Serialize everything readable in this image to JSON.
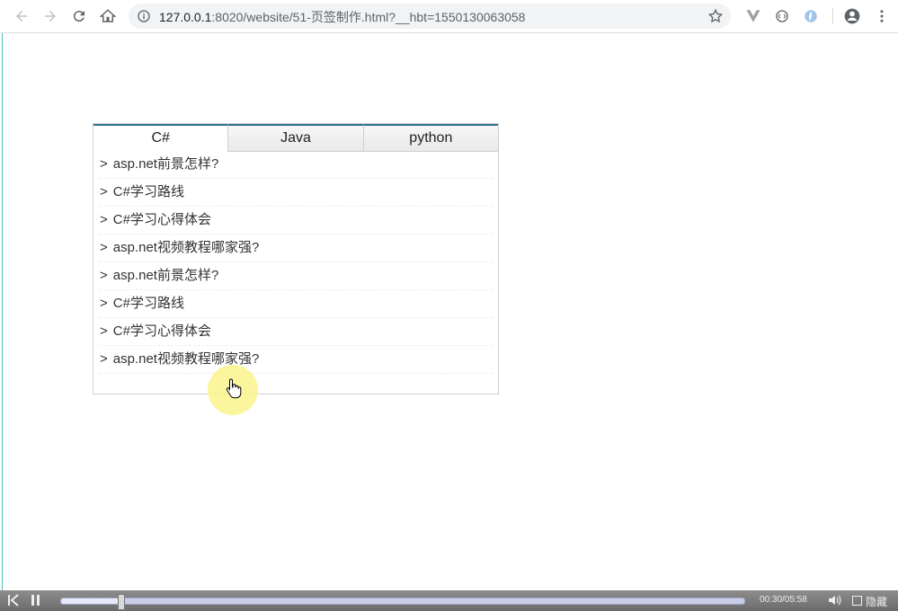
{
  "browser": {
    "url_host": "127.0.0.1",
    "url_rest": ":8020/website/51-页签制作.html?__hbt=1550130063058"
  },
  "tabs": [
    {
      "label": "C#",
      "active": true
    },
    {
      "label": "Java",
      "active": false
    },
    {
      "label": "python",
      "active": false
    }
  ],
  "list_arrow": ">",
  "items": [
    "asp.net前景怎样?",
    "C#学习路线",
    "C#学习心得体会",
    "asp.net视频教程哪家强?",
    "asp.net前景怎样?",
    "C#学习路线",
    "C#学习心得体会",
    "asp.net视频教程哪家强?"
  ],
  "player": {
    "time": "00:30/05:58",
    "hide_label": "隐藏",
    "progress": 0.087
  },
  "colors": {
    "tab_accent": "#2f6f8f",
    "page_edge": "#4fc3b3",
    "cursor_halo": "#faf58c"
  },
  "icons": [
    "back-icon",
    "forward-icon",
    "reload-icon",
    "home-icon",
    "info-icon",
    "star-icon",
    "vuejs-extension-icon",
    "extension-icon",
    "extension-icon-2",
    "account-icon",
    "menu-icon",
    "hand-cursor-icon",
    "skip-back-icon",
    "pause-icon",
    "volume-icon"
  ]
}
